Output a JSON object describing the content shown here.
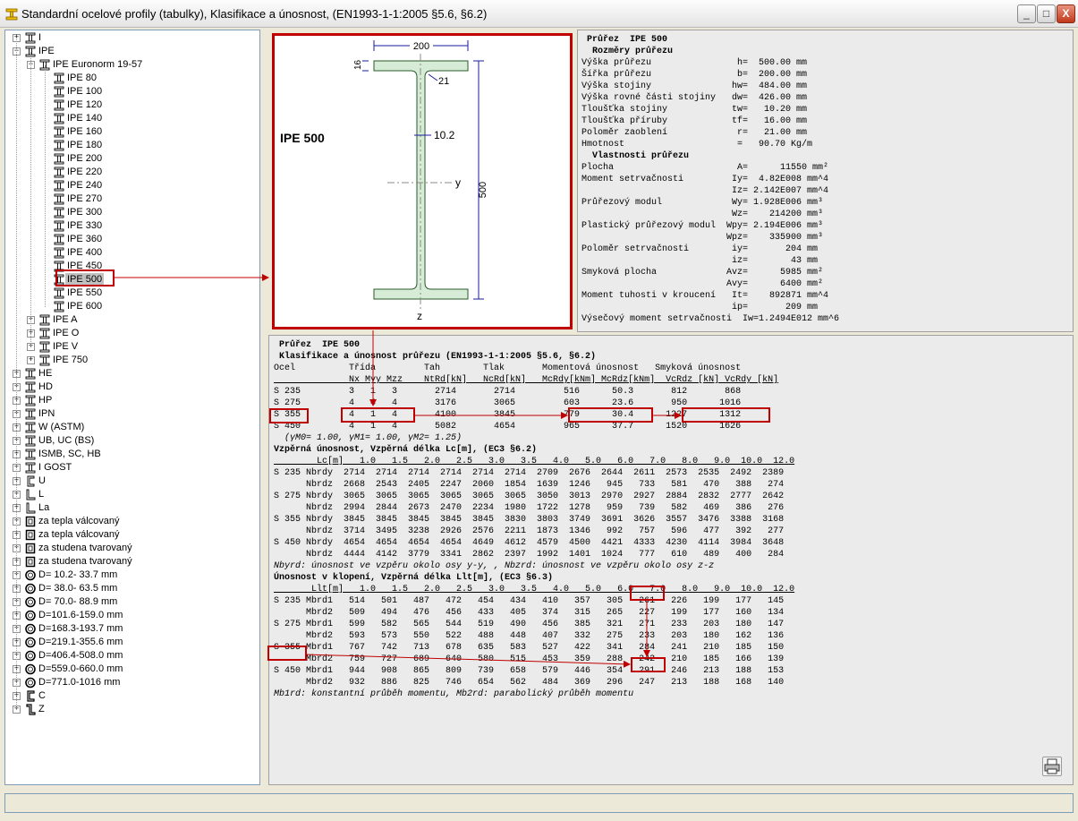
{
  "window": {
    "title": "Standardní ocelové profily (tabulky), Klasifikace a únosnost, (EN1993-1-1:2005 §5.6, §6.2)",
    "buttons": {
      "minimize": "_",
      "maximize": "□",
      "close": "X"
    }
  },
  "tree": {
    "groups_top": [
      {
        "label": "I",
        "toggle": "+",
        "icon": "i-beam-icon"
      },
      {
        "label": "IPE",
        "toggle": "−",
        "icon": "i-beam-icon"
      }
    ],
    "euronorm": {
      "label": "IPE  Euronorm 19-57",
      "toggle": "−",
      "icon": "i-beam-icon"
    },
    "ipe_items": [
      "IPE 80",
      "IPE 100",
      "IPE 120",
      "IPE 140",
      "IPE 160",
      "IPE 180",
      "IPE 200",
      "IPE 220",
      "IPE 240",
      "IPE 270",
      "IPE 300",
      "IPE 330",
      "IPE 360",
      "IPE 400",
      "IPE 450",
      "IPE 500",
      "IPE 550",
      "IPE 600"
    ],
    "selected_item": "IPE 500",
    "ipe_sub": [
      {
        "label": "IPE A",
        "toggle": "+"
      },
      {
        "label": "IPE O",
        "toggle": "+"
      },
      {
        "label": "IPE V",
        "toggle": "+"
      },
      {
        "label": "IPE 750",
        "toggle": "+"
      }
    ],
    "groups_bottom": [
      {
        "label": "HE",
        "toggle": "+",
        "icon": "i-beam-icon"
      },
      {
        "label": "HD",
        "toggle": "+",
        "icon": "i-beam-icon"
      },
      {
        "label": "HP",
        "toggle": "+",
        "icon": "i-beam-icon"
      },
      {
        "label": "IPN",
        "toggle": "+",
        "icon": "i-beam-icon"
      },
      {
        "label": "W (ASTM)",
        "toggle": "+",
        "icon": "i-beam-icon"
      },
      {
        "label": "UB, UC (BS)",
        "toggle": "+",
        "icon": "i-beam-icon"
      },
      {
        "label": "ISMB, SC, HB",
        "toggle": "+",
        "icon": "i-beam-icon"
      },
      {
        "label": "I GOST",
        "toggle": "+",
        "icon": "i-beam-icon"
      },
      {
        "label": "U",
        "toggle": "+",
        "icon": "channel-icon"
      },
      {
        "label": "L",
        "toggle": "+",
        "icon": "angle-icon"
      },
      {
        "label": "La",
        "toggle": "+",
        "icon": "angle-icon"
      },
      {
        "label": "za tepla válcovaný",
        "toggle": "+",
        "icon": "rect-tube-icon"
      },
      {
        "label": "za tepla válcovaný",
        "toggle": "+",
        "icon": "rect-tube-icon"
      },
      {
        "label": "za studena tvarovaný",
        "toggle": "+",
        "icon": "rect-tube-icon"
      },
      {
        "label": "za studena tvarovaný",
        "toggle": "+",
        "icon": "rect-tube-icon"
      },
      {
        "label": "D= 10.2- 33.7 mm",
        "toggle": "+",
        "icon": "circular-tube-icon"
      },
      {
        "label": "D= 38.0- 63.5 mm",
        "toggle": "+",
        "icon": "circular-tube-icon"
      },
      {
        "label": "D= 70.0- 88.9 mm",
        "toggle": "+",
        "icon": "circular-tube-icon"
      },
      {
        "label": "D=101.6-159.0 mm",
        "toggle": "+",
        "icon": "circular-tube-icon"
      },
      {
        "label": "D=168.3-193.7 mm",
        "toggle": "+",
        "icon": "circular-tube-icon"
      },
      {
        "label": "D=219.1-355.6 mm",
        "toggle": "+",
        "icon": "circular-tube-icon"
      },
      {
        "label": "D=406.4-508.0 mm",
        "toggle": "+",
        "icon": "circular-tube-icon"
      },
      {
        "label": "D=559.0-660.0 mm",
        "toggle": "+",
        "icon": "circular-tube-icon"
      },
      {
        "label": "D=771.0-1016 mm",
        "toggle": "+",
        "icon": "circular-tube-icon"
      },
      {
        "label": "C",
        "toggle": "+",
        "icon": "c-section-icon"
      },
      {
        "label": "Z",
        "toggle": "+",
        "icon": "z-section-icon"
      }
    ]
  },
  "drawing": {
    "profile_name": "IPE 500",
    "dim_width": "200",
    "dim_flange": "16",
    "dim_radius": "21",
    "dim_web": "10.2",
    "dim_height": "500",
    "axis_y": "y",
    "axis_z": "z",
    "colors": {
      "fill": "#d6ecd6",
      "stroke": "#2a5a2a",
      "dim": "#1a1aa0",
      "highlight": "#c00000"
    }
  },
  "properties_lines": [
    {
      "text": " Průřez  IPE 500",
      "style": "b"
    },
    {
      "text": "  Rozměry průřezu",
      "style": "b"
    },
    {
      "text": "Výška průřezu                h=  500.00 mm",
      "style": ""
    },
    {
      "text": "Šířka průřezu                b=  200.00 mm",
      "style": ""
    },
    {
      "text": "Výška stojiny               hw=  484.00 mm",
      "style": ""
    },
    {
      "text": "Výška rovné části stojiny   dw=  426.00 mm",
      "style": ""
    },
    {
      "text": "Tloušťka stojiny            tw=   10.20 mm",
      "style": ""
    },
    {
      "text": "Tloušťka příruby            tf=   16.00 mm",
      "style": ""
    },
    {
      "text": "Poloměr zaoblení             r=   21.00 mm",
      "style": ""
    },
    {
      "text": "Hmotnost                     =   90.70 Kg/m",
      "style": ""
    },
    {
      "text": "  Vlastnosti průřezu",
      "style": "b"
    },
    {
      "text": "Plocha                       A=      11550 mm²",
      "style": ""
    },
    {
      "text": "Moment setrvačnosti         Iy=  4.82E008 mm^4",
      "style": ""
    },
    {
      "text": "                            Iz= 2.142E007 mm^4",
      "style": ""
    },
    {
      "text": "Průřezový modul             Wy= 1.928E006 mm³",
      "style": ""
    },
    {
      "text": "                            Wz=    214200 mm³",
      "style": ""
    },
    {
      "text": "Plastický průřezový modul  Wpy= 2.194E006 mm³",
      "style": ""
    },
    {
      "text": "                           Wpz=    335900 mm³",
      "style": ""
    },
    {
      "text": "Poloměr setrvačnosti        iy=       204 mm",
      "style": ""
    },
    {
      "text": "                            iz=        43 mm",
      "style": ""
    },
    {
      "text": "Smyková plocha             Avz=      5985 mm²",
      "style": ""
    },
    {
      "text": "                           Avy=      6400 mm²",
      "style": ""
    },
    {
      "text": "Moment tuhosti v kroucení   It=    892871 mm^4",
      "style": ""
    },
    {
      "text": "                            ip=       209 mm",
      "style": ""
    },
    {
      "text": "Výsečový moment setrvačnosti  Iw=1.2494E012 mm^6",
      "style": ""
    }
  ],
  "results_lines": [
    {
      "text": " Průřez  IPE 500",
      "style": "b"
    },
    {
      "text": " Klasifikace a únosnost průřezu (EN1993-1-1:2005 §5.6, §6.2)",
      "style": "b"
    },
    {
      "text": "Ocel          Třída         Tah        Tlak       Momentová únosnost   Smyková únosnost",
      "style": ""
    },
    {
      "text": "              Nx Myy Mzz    NtRd[kN]   NcRd[kN]   McRdy[kNm] McRdz[kNm]  VcRdz [kN] VcRdy [kN]",
      "style": "u"
    },
    {
      "text": "S 235         3   1   3       2714       2714         516      50.3       812       868",
      "style": ""
    },
    {
      "text": "S 275         4   4   4       3176       3065         603      23.6       950      1016",
      "style": ""
    },
    {
      "text": "S 355         4   1   4       4100       3845         779      30.4      1227      1312",
      "style": ""
    },
    {
      "text": "S 450         4   1   4       5082       4654         965      37.7      1520      1626",
      "style": ""
    },
    {
      "text": "  (γM0= 1.00, γM1= 1.00, γM2= 1.25)",
      "style": "i"
    },
    {
      "text": "Vzpěrná únosnost, Vzpěrná délka Lc[m], (EC3 §6.2)",
      "style": "b"
    },
    {
      "text": "        Lc[m]   1.0   1.5   2.0   2.5   3.0   3.5   4.0   5.0   6.0   7.0   8.0   9.0  10.0  12.0",
      "style": "u"
    },
    {
      "text": "S 235 Nbrdy  2714  2714  2714  2714  2714  2714  2709  2676  2644  2611  2573  2535  2492  2389",
      "style": ""
    },
    {
      "text": "      Nbrdz  2668  2543  2405  2247  2060  1854  1639  1246   945   733   581   470   388   274",
      "style": ""
    },
    {
      "text": "S 275 Nbrdy  3065  3065  3065  3065  3065  3065  3050  3013  2970  2927  2884  2832  2777  2642",
      "style": ""
    },
    {
      "text": "      Nbrdz  2994  2844  2673  2470  2234  1980  1722  1278   959   739   582   469   386   276",
      "style": ""
    },
    {
      "text": "S 355 Nbrdy  3845  3845  3845  3845  3845  3830  3803  3749  3691  3626  3557  3476  3388  3168",
      "style": ""
    },
    {
      "text": "      Nbrdz  3714  3495  3238  2926  2576  2211  1873  1346   992   757   596   477   392   277",
      "style": ""
    },
    {
      "text": "S 450 Nbrdy  4654  4654  4654  4654  4649  4612  4579  4500  4421  4333  4230  4114  3984  3648",
      "style": ""
    },
    {
      "text": "      Nbrdz  4444  4142  3779  3341  2862  2397  1992  1401  1024   777   610   489   400   284",
      "style": ""
    },
    {
      "text": "Nbyrd: únosnost ve vzpěru okolo osy y-y, , Nbzrd: únosnost ve vzpěru okolo osy z-z",
      "style": "i"
    },
    {
      "text": "Únosnost v klopení, Vzpěrná délka Llt[m], (EC3 §6.3)",
      "style": "b"
    },
    {
      "text": "       Llt[m]   1.0   1.5   2.0   2.5   3.0   3.5   4.0   5.0   6.0   7.0   8.0   9.0  10.0  12.0",
      "style": "u"
    },
    {
      "text": "S 235 Mbrd1   514   501   487   472   454   434   410   357   305   261   226   199   177   145",
      "style": ""
    },
    {
      "text": "      Mbrd2   509   494   476   456   433   405   374   315   265   227   199   177   160   134",
      "style": ""
    },
    {
      "text": "S 275 Mbrd1   599   582   565   544   519   490   456   385   321   271   233   203   180   147",
      "style": ""
    },
    {
      "text": "      Mbrd2   593   573   550   522   488   448   407   332   275   233   203   180   162   136",
      "style": ""
    },
    {
      "text": "S 355 Mbrd1   767   742   713   678   635   583   527   422   341   284   241   210   185   150",
      "style": ""
    },
    {
      "text": "      Mbrd2   759   727   689   640   580   515   453   359   288   242   210   185   166   139",
      "style": ""
    },
    {
      "text": "S 450 Mbrd1   944   908   865   809   739   658   579   446   354   291   246   213   188   153",
      "style": ""
    },
    {
      "text": "      Mbrd2   932   886   825   746   654   562   484   369   296   247   213   188   168   140",
      "style": ""
    },
    {
      "text": "Mb1rd: konstantní průběh momentu, Mb2rd: parabolický průběh momentu",
      "style": "i"
    }
  ],
  "results_toolbar": {
    "print_icon": "printer-icon"
  }
}
